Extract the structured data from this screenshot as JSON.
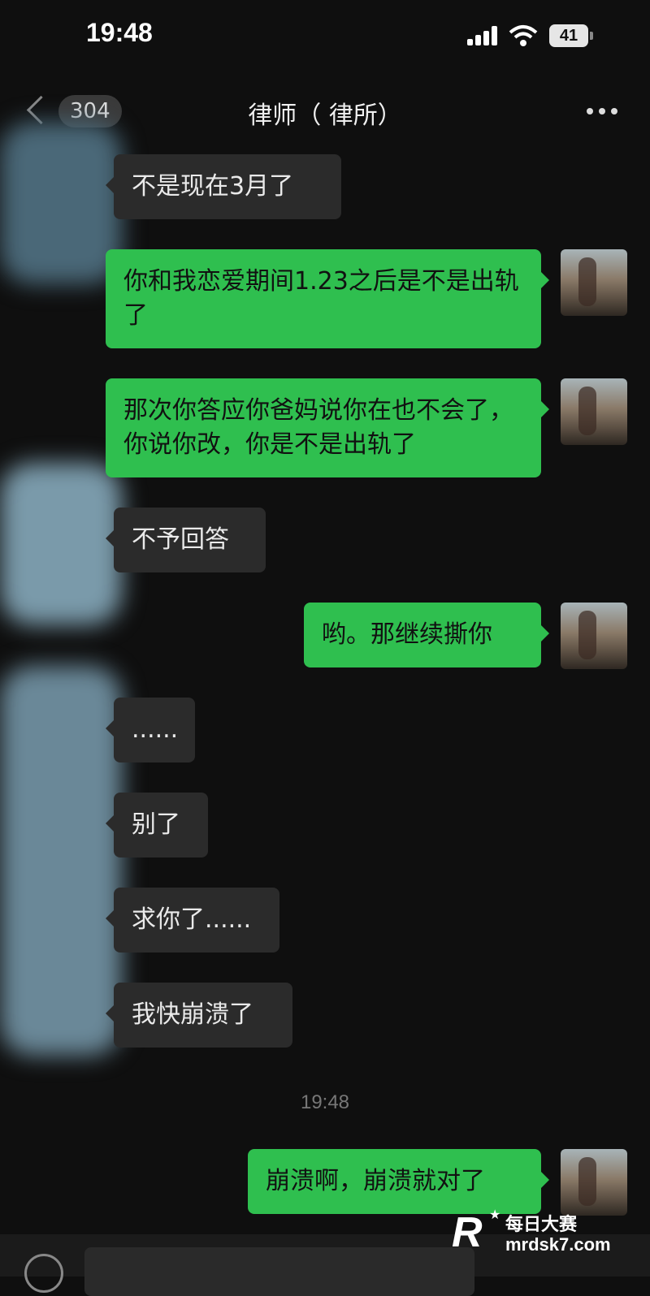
{
  "status_bar": {
    "time": "19:48",
    "battery": "41"
  },
  "header": {
    "back_count": "304",
    "contact_name": "律师（ 律所）"
  },
  "messages": [
    {
      "side": "in",
      "text": "不是现在3月了"
    },
    {
      "side": "out",
      "text": "你和我恋爱期间1.23之后是不是出轨了"
    },
    {
      "side": "out",
      "text": "那次你答应你爸妈说你在也不会了，你说你改，你是不是出轨了"
    },
    {
      "side": "in",
      "text": "不予回答"
    },
    {
      "side": "out",
      "text": "哟。那继续撕你"
    },
    {
      "side": "in",
      "text": "......"
    },
    {
      "side": "in",
      "text": "别了"
    },
    {
      "side": "in",
      "text": "求你了......"
    },
    {
      "side": "in",
      "text": "我快崩溃了"
    },
    {
      "side": "out",
      "text": "崩溃啊，崩溃就对了"
    }
  ],
  "timestamp": "19:48",
  "watermark": {
    "logo": "R",
    "name": "每日大赛",
    "url": "mrdsk7.com"
  },
  "colors": {
    "background": "#0f0f0f",
    "incoming_bubble": "#2b2b2b",
    "outgoing_bubble": "#2fbf4f"
  }
}
